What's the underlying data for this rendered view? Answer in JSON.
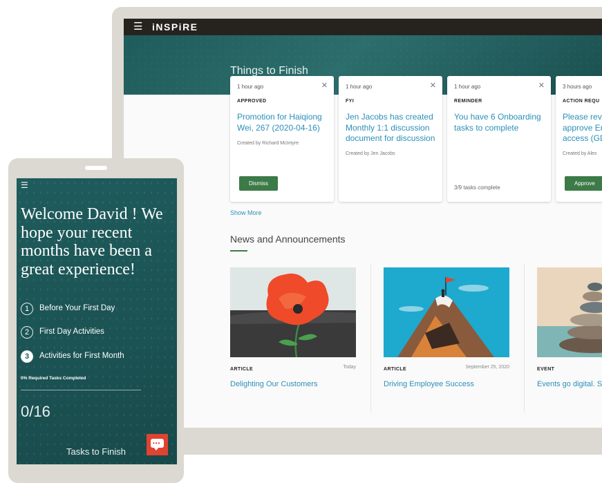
{
  "desktop": {
    "brand": "iNSPiRE",
    "menu_icon": "hamburger-icon",
    "section_title": "Things to Finish",
    "cards": [
      {
        "time": "1 hour ago",
        "type": "APPROVED",
        "title": "Promotion for Haiqiong Wei, 267 (2020-04-16)",
        "created_by": "Created by Richard McIntyre",
        "button": "Dismiss"
      },
      {
        "time": "1 hour ago",
        "type": "FYI",
        "title": "Jen Jacobs has created Monthly 1:1 discussion document for discussion",
        "created_by": "Created by Jen Jacobs"
      },
      {
        "time": "1 hour ago",
        "type": "REMINDER",
        "title": "You have 6 Onboarding tasks to complete",
        "progress": "3/9 tasks complete"
      },
      {
        "time": "3 hours ago",
        "type": "ACTION REQU",
        "title": "Please revi approve Er access (GD",
        "created_by": "Created by Alex",
        "button": "Approve"
      }
    ],
    "show_more": "Show More",
    "news_title": "News and Announcements",
    "news": [
      {
        "type": "ARTICLE",
        "date": "Today",
        "headline": "Delighting Our Customers"
      },
      {
        "type": "ARTICLE",
        "date": "September 25, 2020",
        "headline": "Driving Employee Success"
      },
      {
        "type": "EVENT",
        "date": "",
        "headline": "Events go digital. S"
      }
    ]
  },
  "mobile": {
    "menu_icon": "hamburger-icon",
    "welcome": "Welcome David ! We hope your recent months have been a great experience!",
    "steps": [
      {
        "num": "1",
        "label": "Before Your First Day"
      },
      {
        "num": "2",
        "label": "First Day Activities"
      },
      {
        "num": "3",
        "label": "Activities for First Month"
      }
    ],
    "required_tasks": "0% Required Tasks Completed",
    "task_count": "0/16",
    "tasks_to_finish": "Tasks to Finish",
    "chat_icon": "chat-icon"
  },
  "colors": {
    "teal": "#1f5c5d",
    "accent_green": "#3c7a47",
    "link_blue": "#2b8fb8",
    "chat_red": "#e0432f"
  }
}
